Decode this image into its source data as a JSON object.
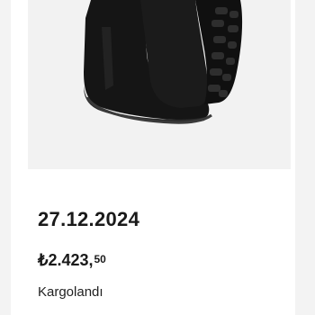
{
  "order": {
    "date": "27.12.2024",
    "price_main": "₺2.423,",
    "price_cents": "50",
    "status": "Kargolandı"
  },
  "product": {
    "image_icon": "black-rubber-boots"
  },
  "colors": {
    "card_bg": "#ffffff",
    "page_bg": "#f3f3f3",
    "image_bg": "#f2f2f2",
    "text": "#1a1a1a"
  }
}
